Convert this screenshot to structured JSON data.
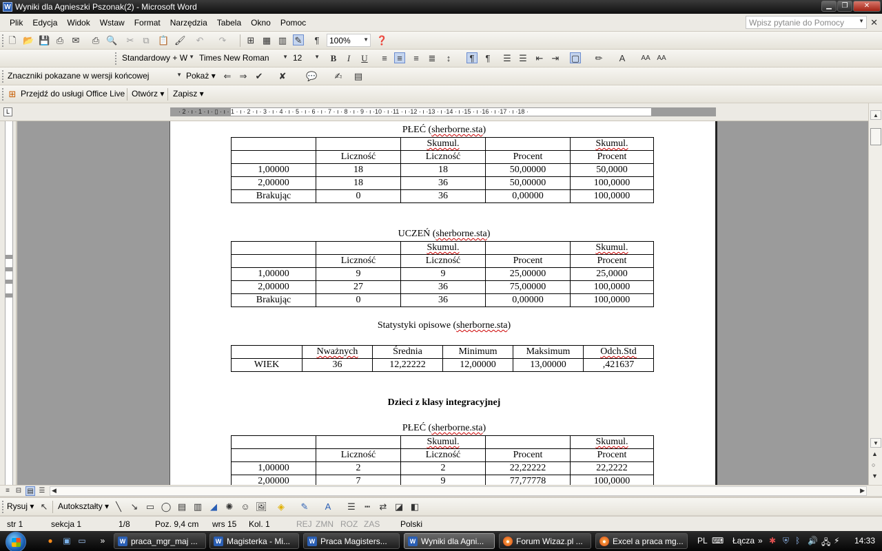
{
  "window": {
    "title": "Wyniki dla Agnieszki Pszonak(2) - Microsoft Word",
    "app_icon": "W"
  },
  "menu": {
    "items": [
      "Plik",
      "Edycja",
      "Widok",
      "Wstaw",
      "Format",
      "Narzędzia",
      "Tabela",
      "Okno",
      "Pomoc"
    ],
    "help_placeholder": "Wpisz pytanie do Pomocy"
  },
  "toolbar": {
    "zoom": "100%",
    "style": "Standardowy + W",
    "font": "Times New Roman",
    "size": "12",
    "bold": "B",
    "italic": "I",
    "underline": "U",
    "markup_view": "Znaczniki pokazane w wersji końcowej",
    "show_label": "Pokaż",
    "office_live": "Przejdź do usługi Office Live",
    "open_label": "Otwórz",
    "save_label": "Zapisz"
  },
  "ruler": {
    "numbers": "· 2 · ı · 1 · ı · ▯ · ı · 1 · ı · 2 · ı · 3 · ı · 4 · ı · 5 · ı · 6 · ı · 7 · ı · 8 · ı · 9 · ı ·10 · ı ·11 · ı ·12 · ı ·13 · ı ·14 · ı ·15 · ı ·16 · ı ·17 · ı ·18 ·"
  },
  "document": {
    "table1_title_prefix": "PŁEĆ (",
    "table1_title_word": "sherborne.sta",
    "table1": {
      "head1": [
        "",
        "",
        "Skumul.",
        "",
        "Skumul."
      ],
      "head2": [
        "",
        "Liczność",
        "Liczność",
        "Procent",
        "Procent"
      ],
      "rows": [
        [
          "1,00000",
          "18",
          "18",
          "50,00000",
          "50,0000"
        ],
        [
          "2,00000",
          "18",
          "36",
          "50,00000",
          "100,0000"
        ],
        [
          "Brakując",
          "0",
          "36",
          "0,00000",
          "100,0000"
        ]
      ]
    },
    "table2_title_prefix": "UCZEŃ (",
    "table2_title_word": "sherborne.sta",
    "table2": {
      "head1": [
        "",
        "",
        "Skumul.",
        "",
        "Skumul."
      ],
      "head2": [
        "",
        "Liczność",
        "Liczność",
        "Procent",
        "Procent"
      ],
      "rows": [
        [
          "1,00000",
          "9",
          "9",
          "25,00000",
          "25,0000"
        ],
        [
          "2,00000",
          "27",
          "36",
          "75,00000",
          "100,0000"
        ],
        [
          "Brakując",
          "0",
          "36",
          "0,00000",
          "100,0000"
        ]
      ]
    },
    "desc_title_prefix": "Statystyki opisowe (",
    "desc_title_word": "sherborne.sta",
    "desc_table": {
      "head": [
        "",
        "Nważnych",
        "Średnia",
        "Minimum",
        "Maksimum",
        "Odch.Std"
      ],
      "row": [
        "WIEK",
        "36",
        "12,22222",
        "12,00000",
        "13,00000",
        ",421637"
      ]
    },
    "section_heading": "Dzieci z klasy integracyjnej",
    "table3_title_prefix": "PŁEĆ (",
    "table3_title_word": "sherborne.sta",
    "table3": {
      "head1": [
        "",
        "",
        "Skumul.",
        "",
        "Skumul."
      ],
      "head2": [
        "",
        "Liczność",
        "Liczność",
        "Procent",
        "Procent"
      ],
      "rows": [
        [
          "1,00000",
          "2",
          "2",
          "22,22222",
          "22,2222"
        ],
        [
          "2,00000",
          "7",
          "9",
          "77,77778",
          "100,0000"
        ]
      ]
    },
    "close_paren": ")"
  },
  "drawing": {
    "draw_label": "Rysuj",
    "autoshapes_label": "Autokształty"
  },
  "status": {
    "page": "str 1",
    "section": "sekcja 1",
    "pages": "1/8",
    "position": "Poz. 9,4 cm",
    "line": "wrs 15",
    "column": "Kol. 1",
    "rec": "REJ",
    "trk": "ZMN",
    "ext": "ROZ",
    "ovr": "ZAS",
    "language": "Polski"
  },
  "taskbar": {
    "tasks": [
      "praca_mgr_maj ...",
      "Magisterka - Mi...",
      "Praca Magisters...",
      "Wyniki dla Agni...",
      "Forum Wizaz.pl ...",
      "Excel a praca mg..."
    ],
    "lang": "PL",
    "connect": "Łącza",
    "time": "14:33"
  }
}
